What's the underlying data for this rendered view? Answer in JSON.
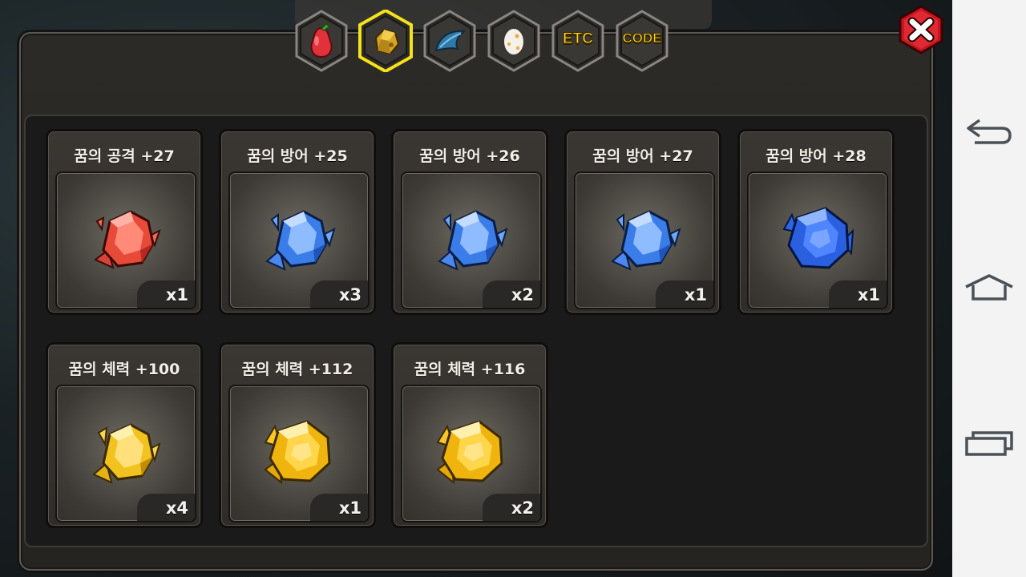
{
  "tabs": [
    {
      "id": "fruit",
      "label": "",
      "icon": "pear-fruit-icon",
      "selected": false
    },
    {
      "id": "gem",
      "label": "",
      "icon": "gold-ore-icon",
      "selected": true
    },
    {
      "id": "feather",
      "label": "",
      "icon": "blue-feather-icon",
      "selected": false
    },
    {
      "id": "egg",
      "label": "",
      "icon": "egg-icon",
      "selected": false
    },
    {
      "id": "etc",
      "label": "ETC",
      "icon": "",
      "selected": false
    },
    {
      "id": "code",
      "label": "CODE",
      "icon": "",
      "selected": false
    }
  ],
  "close_icon": "close-x-icon",
  "items": [
    {
      "title": "꿈의 공격 +27",
      "quantity": "x1",
      "gem": "red-crystal-icon",
      "color": "#e84a3a"
    },
    {
      "title": "꿈의 방어 +25",
      "quantity": "x3",
      "gem": "blue-crystal-icon",
      "color": "#3b7de8"
    },
    {
      "title": "꿈의 방어 +26",
      "quantity": "x2",
      "gem": "blue-crystal-icon",
      "color": "#3b7de8"
    },
    {
      "title": "꿈의 방어 +27",
      "quantity": "x1",
      "gem": "blue-crystal-icon",
      "color": "#3b7de8"
    },
    {
      "title": "꿈의 방어 +28",
      "quantity": "x1",
      "gem": "blue-crystal-icon",
      "color": "#2a5fe0"
    },
    {
      "title": "꿈의 체력 +100",
      "quantity": "x4",
      "gem": "yellow-crystal-icon",
      "color": "#f2c21e"
    },
    {
      "title": "꿈의 체력 +112",
      "quantity": "x1",
      "gem": "yellow-crystal-icon",
      "color": "#efb40e"
    },
    {
      "title": "꿈의 체력 +116",
      "quantity": "x2",
      "gem": "yellow-crystal-icon",
      "color": "#efb40e"
    }
  ],
  "navbar": {
    "back_icon": "back-arrow-icon",
    "home_icon": "home-icon",
    "recents_icon": "recent-apps-icon"
  }
}
